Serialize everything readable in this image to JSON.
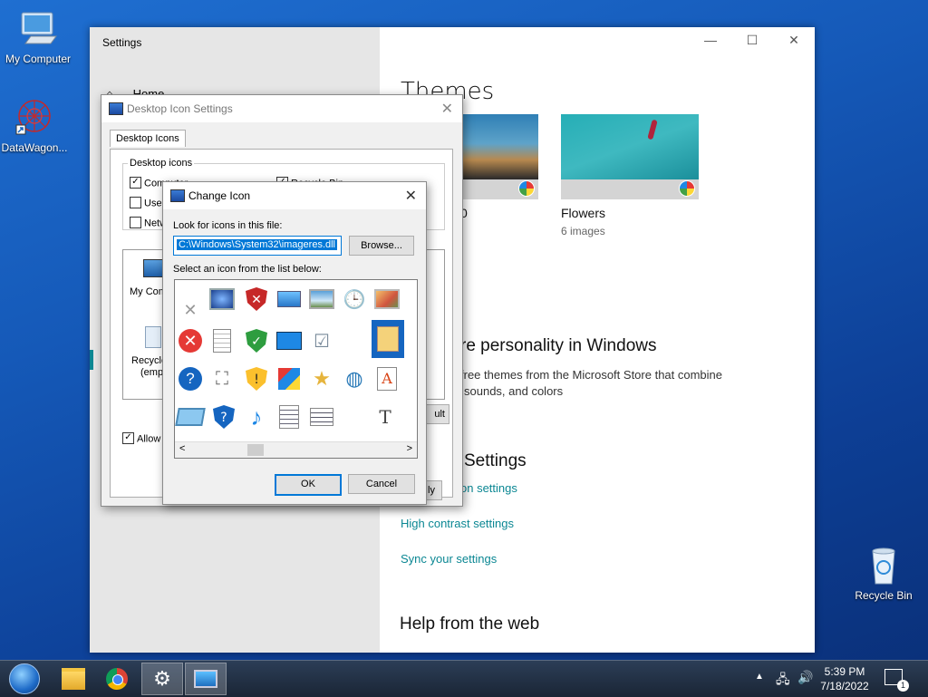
{
  "desktop": {
    "icons": [
      {
        "label": "My Computer",
        "icon": "computer-icon"
      },
      {
        "label": "DataWagon...",
        "icon": "datawagon-icon"
      },
      {
        "label": "Recycle Bin",
        "icon": "recycle-bin-icon"
      }
    ]
  },
  "settings": {
    "window_title": "Settings",
    "home_label": "Home",
    "themes_heading": "Themes",
    "theme_cards": [
      {
        "name": "",
        "count_label": "0"
      },
      {
        "name": "Flowers",
        "count_label": "6 images"
      }
    ],
    "personality_heading": "re personality in Windows",
    "personality_body_1": "free themes from the Microsoft Store that combine",
    "personality_body_2": "sounds, and colors",
    "related_heading": "Settings",
    "links": [
      "on settings",
      "High contrast settings",
      "Sync your settings"
    ],
    "help_heading": "Help from the web",
    "partial_buttons": [
      "ult",
      "ly"
    ]
  },
  "desktop_icon_settings": {
    "title": "Desktop Icon Settings",
    "tab_label": "Desktop Icons",
    "group_label": "Desktop icons",
    "checkboxes": [
      {
        "label": "Computer",
        "checked": true
      },
      {
        "label": "Recycle Bin",
        "checked": true
      },
      {
        "label": "User",
        "checked": false
      },
      {
        "label": "Netw",
        "checked": false
      }
    ],
    "preview_items": [
      "My Comp",
      "Recycle",
      "(empt"
    ],
    "allow_label": "Allow t",
    "allow_checked": true
  },
  "change_icon": {
    "title": "Change Icon",
    "look_label": "Look for icons in this file:",
    "file_path": "C:\\Windows\\System32\\imageres.dll",
    "browse_label": "Browse...",
    "select_label": "Select an icon from the list below:",
    "ok_label": "OK",
    "cancel_label": "Cancel",
    "scroll_left": "<",
    "scroll_right": ">"
  },
  "taskbar": {
    "time": "5:39 PM",
    "date": "7/18/2022",
    "notification_count": "1",
    "apps": [
      "start-orb-icon",
      "file-explorer-icon",
      "chrome-icon",
      "settings-gear-icon",
      "desktop-icon-settings-icon"
    ]
  }
}
